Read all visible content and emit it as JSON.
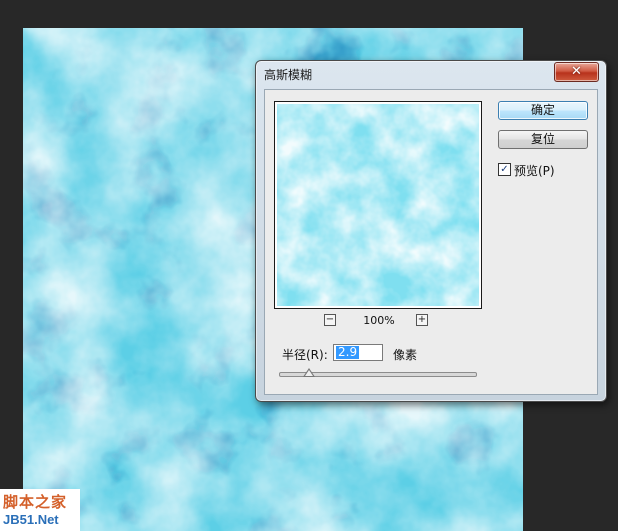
{
  "dialog": {
    "title": "高斯模糊",
    "close_symbol": "✕",
    "ok_label": "确定",
    "reset_label": "复位",
    "preview_checkbox": {
      "label": "预览(P)",
      "checked": true,
      "mark": "✓"
    },
    "zoom": {
      "minus": "−",
      "level": "100%",
      "plus": "+"
    },
    "radius": {
      "label": "半径(R):",
      "value": "2.9",
      "unit": "像素"
    }
  },
  "watermark": {
    "line1": "脚本之家",
    "line2": "JB51.Net"
  },
  "colors": {
    "workspace": "#282828",
    "cloud_base": "#6dd6e8",
    "cloud_dark": "#1e6fa8",
    "cloud_light": "#ffffff"
  },
  "icons": {
    "close": "close-icon",
    "zoom_out": "minus-icon",
    "zoom_in": "plus-icon",
    "checkbox": "checkmark-icon"
  }
}
